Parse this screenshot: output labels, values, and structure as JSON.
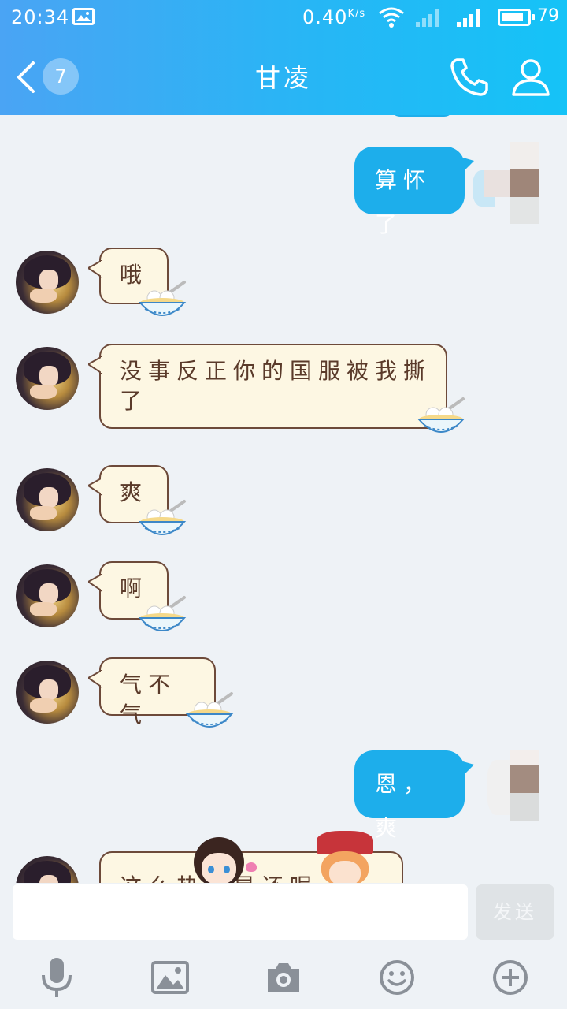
{
  "status_bar": {
    "time": "20:34",
    "speed": "0.40",
    "speed_unit": "K/s",
    "battery": "79"
  },
  "header": {
    "unread_count": "7",
    "title": "甘凌"
  },
  "messages": [
    {
      "side": "out",
      "text": "算怀了"
    },
    {
      "side": "in",
      "text": "哦"
    },
    {
      "side": "in",
      "text": "没事反正你的国服被我撕了"
    },
    {
      "side": "in",
      "text": "爽"
    },
    {
      "side": "in",
      "text": "啊"
    },
    {
      "side": "in",
      "text": "气不气"
    },
    {
      "side": "out",
      "text": "恩，爽"
    },
    {
      "side": "in",
      "text": "这么热…是还呢…"
    }
  ],
  "input": {
    "value": "",
    "send_label": "发送"
  },
  "toolbar": [
    "microphone-icon",
    "image-icon",
    "camera-icon",
    "emoji-icon",
    "plus-icon"
  ],
  "colors": {
    "header_start": "#4aa4f4",
    "header_end": "#15c3f7",
    "out_bubble": "#1daeeb",
    "in_bubble": "#fdf7e3",
    "background": "#eef2f6"
  }
}
